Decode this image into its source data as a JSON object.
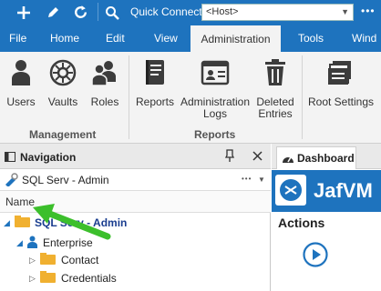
{
  "qat": {
    "quick_connect_label": "Quick Connect",
    "host_placeholder": "<Host>",
    "more": "•••"
  },
  "tabs": [
    "File",
    "Home",
    "Edit",
    "View",
    "Administration",
    "Tools",
    "Wind"
  ],
  "active_tab": "Administration",
  "ribbon": {
    "management": {
      "group_label": "Management",
      "buttons": [
        "Users",
        "Vaults",
        "Roles"
      ]
    },
    "reports": {
      "group_label": "Reports",
      "buttons": [
        "Reports",
        "Administration\nLogs",
        "Deleted\nEntries"
      ]
    },
    "settings": {
      "buttons": [
        "Root Settings"
      ]
    }
  },
  "navigation": {
    "title": "Navigation",
    "datasource": "SQL Serv - Admin",
    "column_header": "Name",
    "tree": [
      {
        "label": "SQL Serv - Admin",
        "level": 0,
        "expanded": true,
        "icon": "database-icon",
        "bold": true
      },
      {
        "label": "Enterprise",
        "level": 1,
        "expanded": true,
        "icon": "user-icon",
        "bold": false
      },
      {
        "label": "Contact",
        "level": 2,
        "expanded": false,
        "icon": "folder-icon",
        "bold": false
      },
      {
        "label": "Credentials",
        "level": 2,
        "expanded": false,
        "icon": "folder-icon",
        "bold": false
      }
    ]
  },
  "dashboard": {
    "tab_label": "Dashboard",
    "banner_title": "JafVM",
    "actions_label": "Actions"
  },
  "colors": {
    "accent": "#1e73be",
    "ribbon_bg": "#f3f3f3",
    "annotation_arrow": "#3cbf2c",
    "folder": "#f0b030"
  }
}
